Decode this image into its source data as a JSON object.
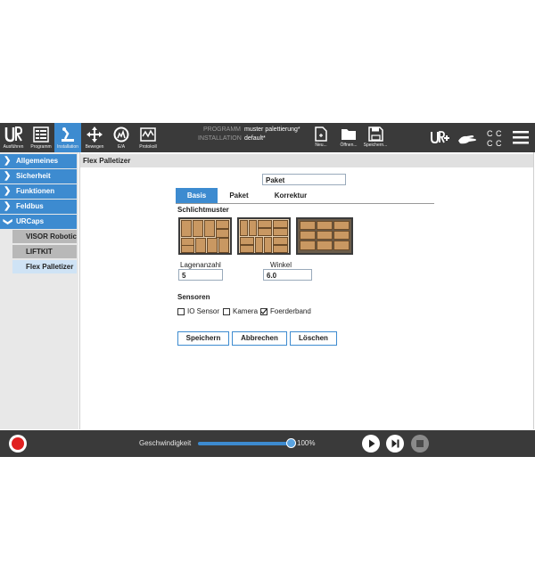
{
  "topbar": {
    "buttons": [
      {
        "label": "Ausführen",
        "icon": "run-icon"
      },
      {
        "label": "Programm",
        "icon": "program-icon"
      },
      {
        "label": "Installation",
        "icon": "installation-icon"
      },
      {
        "label": "Bewegen",
        "icon": "move-icon"
      },
      {
        "label": "E/A",
        "icon": "io-icon"
      },
      {
        "label": "Protokoll",
        "icon": "log-icon"
      }
    ],
    "program_key": "PROGRAMM",
    "program_value": "muster palettierung*",
    "installation_key": "INSTALLATION",
    "installation_value": "default*",
    "file_buttons": [
      {
        "label": "Neu...",
        "icon": "new-file-icon"
      },
      {
        "label": "Öffnen...",
        "icon": "open-folder-icon"
      },
      {
        "label": "Speichern...",
        "icon": "save-icon"
      }
    ]
  },
  "sidebar": {
    "items": [
      {
        "label": "Allgemeines",
        "chevron": ">"
      },
      {
        "label": "Sicherheit",
        "chevron": ">"
      },
      {
        "label": "Funktionen",
        "chevron": ">"
      },
      {
        "label": "Feldbus",
        "chevron": ">"
      },
      {
        "label": "URCaps",
        "chevron": "v"
      }
    ],
    "subitems": [
      {
        "label": "VISOR Robotic"
      },
      {
        "label": "LIFTKIT"
      },
      {
        "label": "Flex Palletizer"
      }
    ]
  },
  "main": {
    "title": "Flex Palletizer",
    "name_value": "Paket",
    "tabs": [
      {
        "label": "Basis"
      },
      {
        "label": "Paket"
      },
      {
        "label": "Korrektur"
      }
    ],
    "section_pattern": "Schlichtmuster",
    "layer_count_label": "Lagenanzahl",
    "layer_count_value": "5",
    "angle_label": "Winkel",
    "angle_value": "6.0",
    "section_sensors": "Sensoren",
    "sensors": [
      {
        "label": "IO Sensor",
        "checked": false
      },
      {
        "label": "Kamera",
        "checked": false
      },
      {
        "label": "Foerderband",
        "checked": true
      }
    ],
    "buttons": {
      "save": "Speichern",
      "cancel": "Abbrechen",
      "delete": "Löschen"
    }
  },
  "bottombar": {
    "speed_label": "Geschwindigkeit",
    "speed_value": "100%",
    "speed_fraction": 1.0
  },
  "colors": {
    "accent": "#3d8bd0",
    "dark_bar": "#3a3a3a",
    "record": "#e02020"
  }
}
